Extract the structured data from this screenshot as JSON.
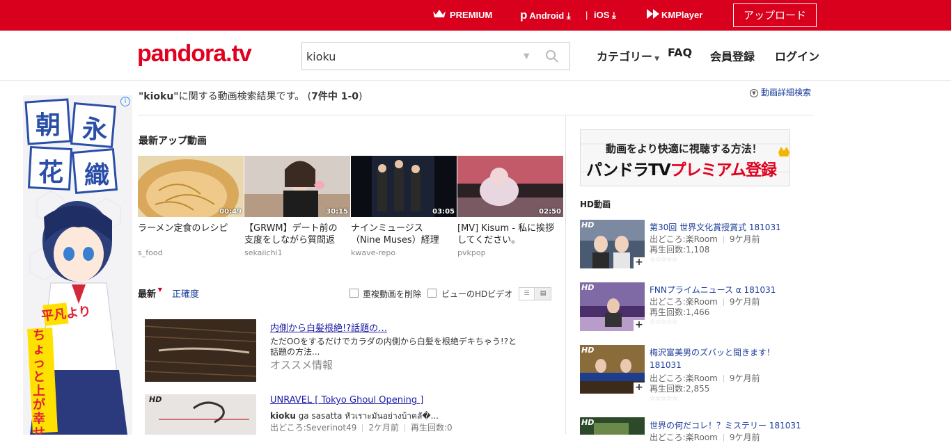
{
  "topbar": {
    "premium": "PREMIUM",
    "android": "Android",
    "ios": "iOS",
    "kmplayer": "KMPlayer",
    "upload": "アップロード"
  },
  "header": {
    "logo": "pandora.tv",
    "search_value": "kioku",
    "nav": [
      "カテゴリー",
      "FAQ",
      "会員登録",
      "ログイン"
    ]
  },
  "results": {
    "query": "\"kioku\"",
    "suffix": "に関する動画検索結果です。 (",
    "count": "7件中",
    "range": " 1-0",
    "close": ")",
    "advanced": "動画詳細検索"
  },
  "latest": {
    "title": "最新アップ動画",
    "items": [
      {
        "title": "ラーメン定食のレシピ",
        "source": "s_food",
        "duration": "00:49"
      },
      {
        "title": "【GRWM】デート前の支度をしながら質問返",
        "source": "sekaiichi1",
        "duration": "30:15"
      },
      {
        "title": "ナインミュージス（Nine Muses）経理",
        "source": "kwave-repo",
        "duration": "03:05"
      },
      {
        "title": "[MV] Kisum - 私に挨拶してください。",
        "source": "pvkpop",
        "duration": "02:50"
      }
    ]
  },
  "sort": {
    "newest": "最新",
    "accuracy": "正確度",
    "dedupe": "重複動画を削除",
    "hd_view": "ビューのHDビデオ"
  },
  "list": [
    {
      "title": "内側から白髪根絶!?話題の…",
      "desc": "ただOOをするだけでカラダの内側から白髪を根絶デキちゃう!?と話題の方法...",
      "tag": "オススメ情報"
    },
    {
      "title": "UNRAVEL [ Tokyo Ghoul Opening ]",
      "desc_bold": "kioku",
      "desc": " ga sasatta หัวเราะมันอย่างบ้าคลั�...",
      "source": "出どころ:Severinot49",
      "ago": "2ケ月前",
      "plays": "再生回数:0",
      "hd": "HD"
    }
  ],
  "premium_banner": {
    "line1": "動画をより快適に視聴する方法！",
    "line2a": "パンドラTV",
    "line2b": "プレミアム登録"
  },
  "hd_section": {
    "title": "HD動画",
    "badge": "HD",
    "items": [
      {
        "title": "第30回 世界文化賞授賞式 181031",
        "source": "出どころ:楽Room",
        "ago": "9ケ月前",
        "plays": "再生回数:1,108"
      },
      {
        "title": "FNNプライムニュース α 181031",
        "source": "出どころ:楽Room",
        "ago": "9ケ月前",
        "plays": "再生回数:1,466"
      },
      {
        "title": "梅沢富美男のズバッと聞きます！",
        "title2": "181031",
        "source": "出どころ:楽Room",
        "ago": "9ケ月前",
        "plays": "再生回数:2,855"
      },
      {
        "title": "世界の何だコレ！？ミステリー 181031",
        "source": "出どころ:楽Room",
        "ago": "9ケ月前",
        "plays": ""
      }
    ]
  },
  "ad": {
    "kanji": [
      "朝",
      "永",
      "花",
      "織"
    ],
    "slogan1": "平凡より",
    "slogan2": "ちょっと上が幸せ"
  },
  "colors": {
    "brand": "#d8001c",
    "link": "#1a3d9a"
  }
}
